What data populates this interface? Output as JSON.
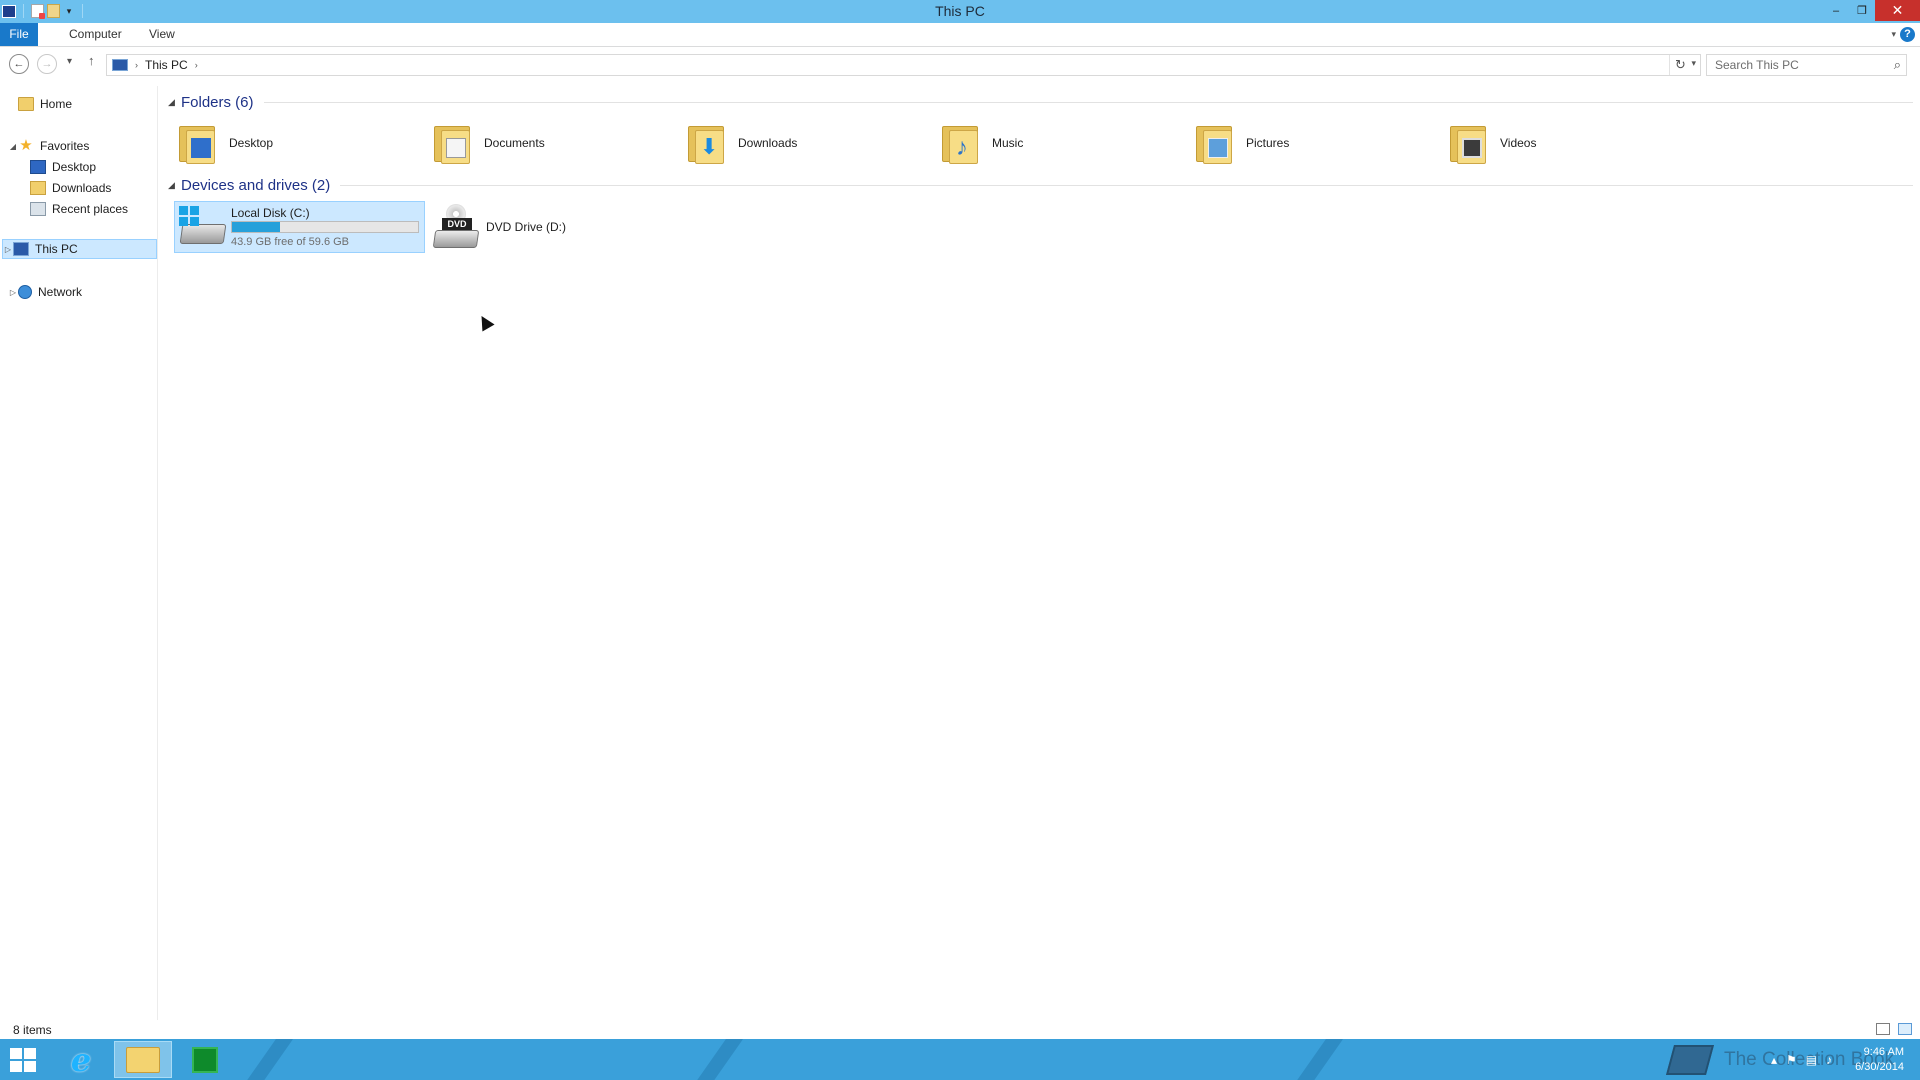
{
  "window": {
    "title": "This PC",
    "buttons": {
      "minimize": "–",
      "restore": "❐",
      "close": "✕"
    }
  },
  "ribbon": {
    "tabs": [
      "File",
      "Computer",
      "View"
    ],
    "help": "?"
  },
  "address": {
    "crumb": "This PC",
    "search_placeholder": "Search This PC"
  },
  "nav": {
    "home": "Home",
    "favorites": "Favorites",
    "favorites_items": [
      "Desktop",
      "Downloads",
      "Recent places"
    ],
    "this_pc": "This PC",
    "network": "Network"
  },
  "folders": {
    "header": "Folders (6)",
    "items": [
      "Desktop",
      "Documents",
      "Downloads",
      "Music",
      "Pictures",
      "Videos"
    ]
  },
  "devices": {
    "header": "Devices and drives (2)",
    "local_disk": {
      "name": "Local Disk (C:)",
      "free_text": "43.9 GB free of 59.6 GB",
      "used_fraction": 0.26
    },
    "dvd": {
      "name": "DVD Drive (D:)",
      "badge": "DVD"
    }
  },
  "status": {
    "count": "8 items"
  },
  "taskbar": {
    "time": "9:46 AM",
    "date": "6/30/2014",
    "watermark": "The Collection Book"
  },
  "colors": {
    "titlebar": "#6cc0ee",
    "accent": "#1979ca",
    "selection": "#cce8ff",
    "taskbar": "#3aa0da"
  }
}
